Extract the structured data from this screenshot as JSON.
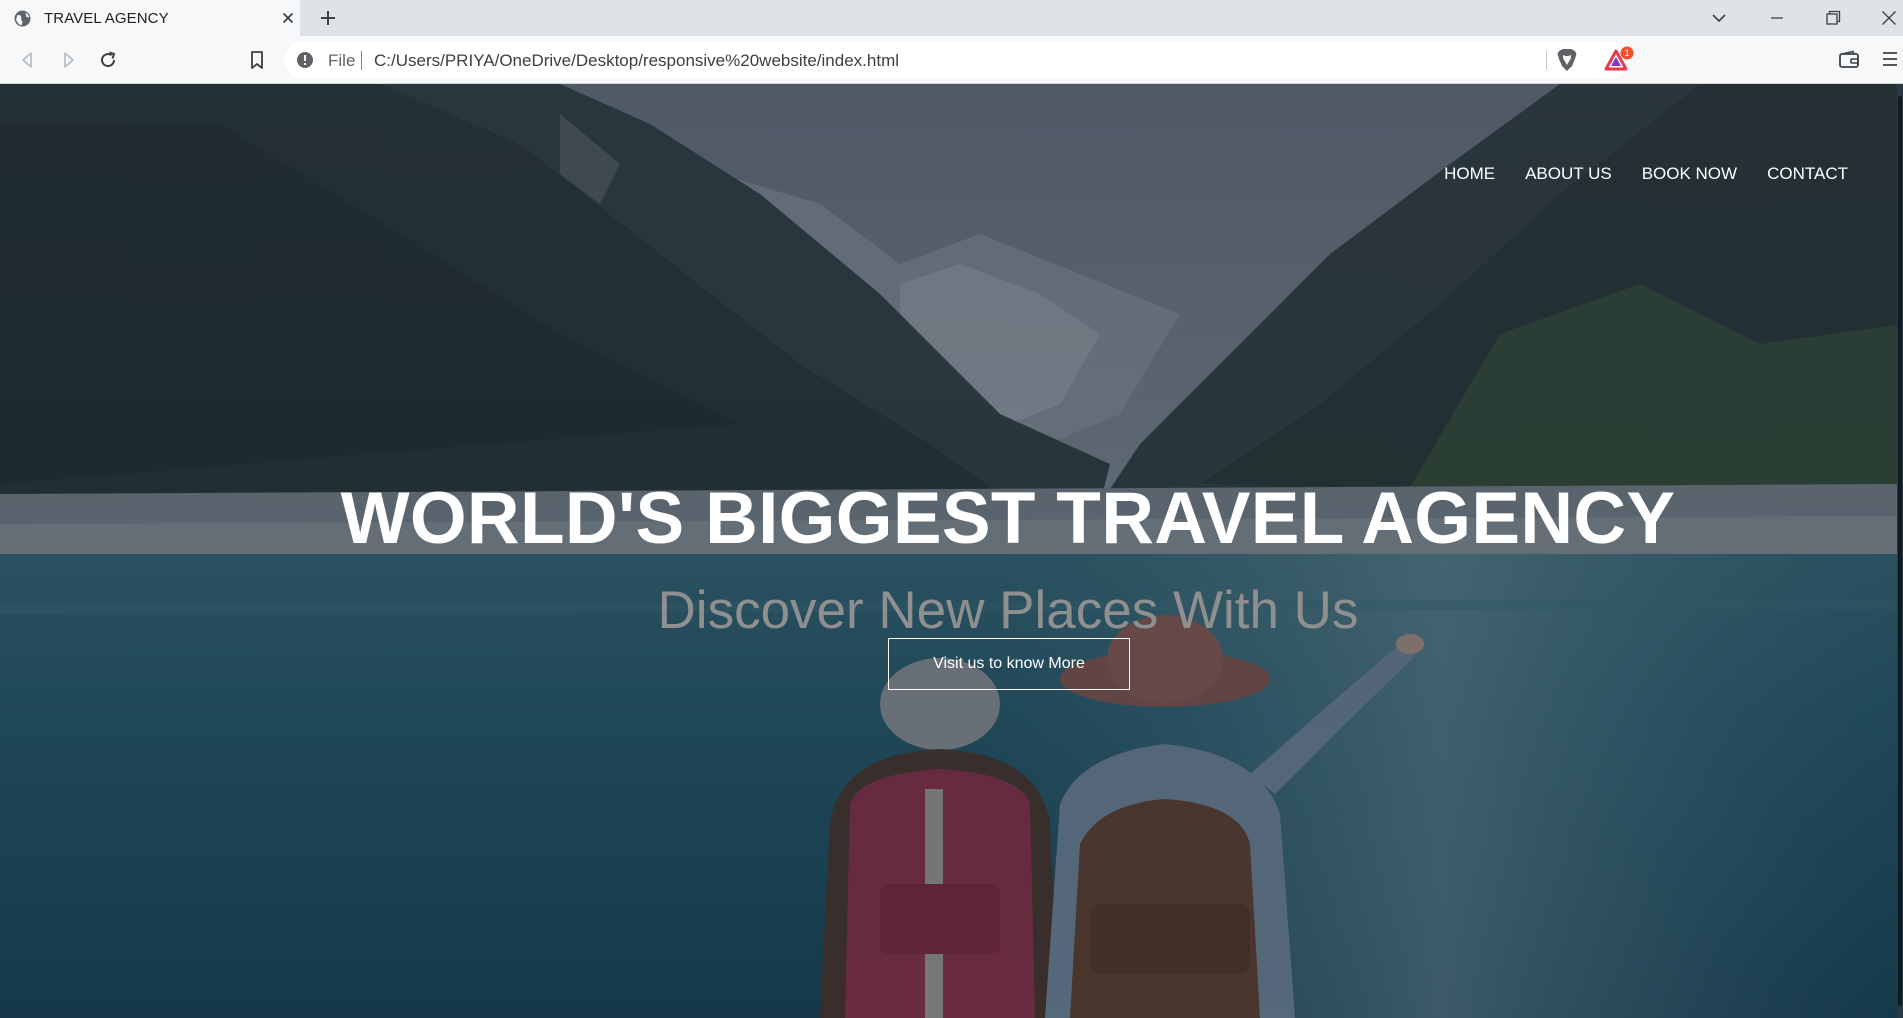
{
  "browser": {
    "tab": {
      "title": "TRAVEL AGENCY",
      "favicon": "globe-icon"
    },
    "address_bar": {
      "scheme_label": "File",
      "url": "C:/Users/PRIYA/OneDrive/Desktop/responsive%20website/index.html"
    },
    "rewards_badge": "1",
    "icons": {
      "back": "back-arrow-icon",
      "forward": "forward-arrow-icon",
      "reload": "reload-icon",
      "bookmark": "bookmark-icon",
      "shields": "brave-shield-icon",
      "rewards": "brave-rewards-icon",
      "wallet": "wallet-icon",
      "menu": "hamburger-menu-icon"
    }
  },
  "site": {
    "nav": {
      "items": [
        {
          "label": "HOME"
        },
        {
          "label": "ABOUT US"
        },
        {
          "label": "BOOK NOW"
        },
        {
          "label": "CONTACT"
        }
      ]
    },
    "hero": {
      "title": "WORLD'S BIGGEST TRAVEL AGENCY",
      "subtitle": "Discover New Places With Us",
      "cta_label": "Visit us to know More"
    },
    "colors": {
      "overlay": "#1f2c3a",
      "lake": "#1d4f63",
      "nav_text": "#ffffff",
      "subtitle_text": "#8f8f8f"
    }
  }
}
